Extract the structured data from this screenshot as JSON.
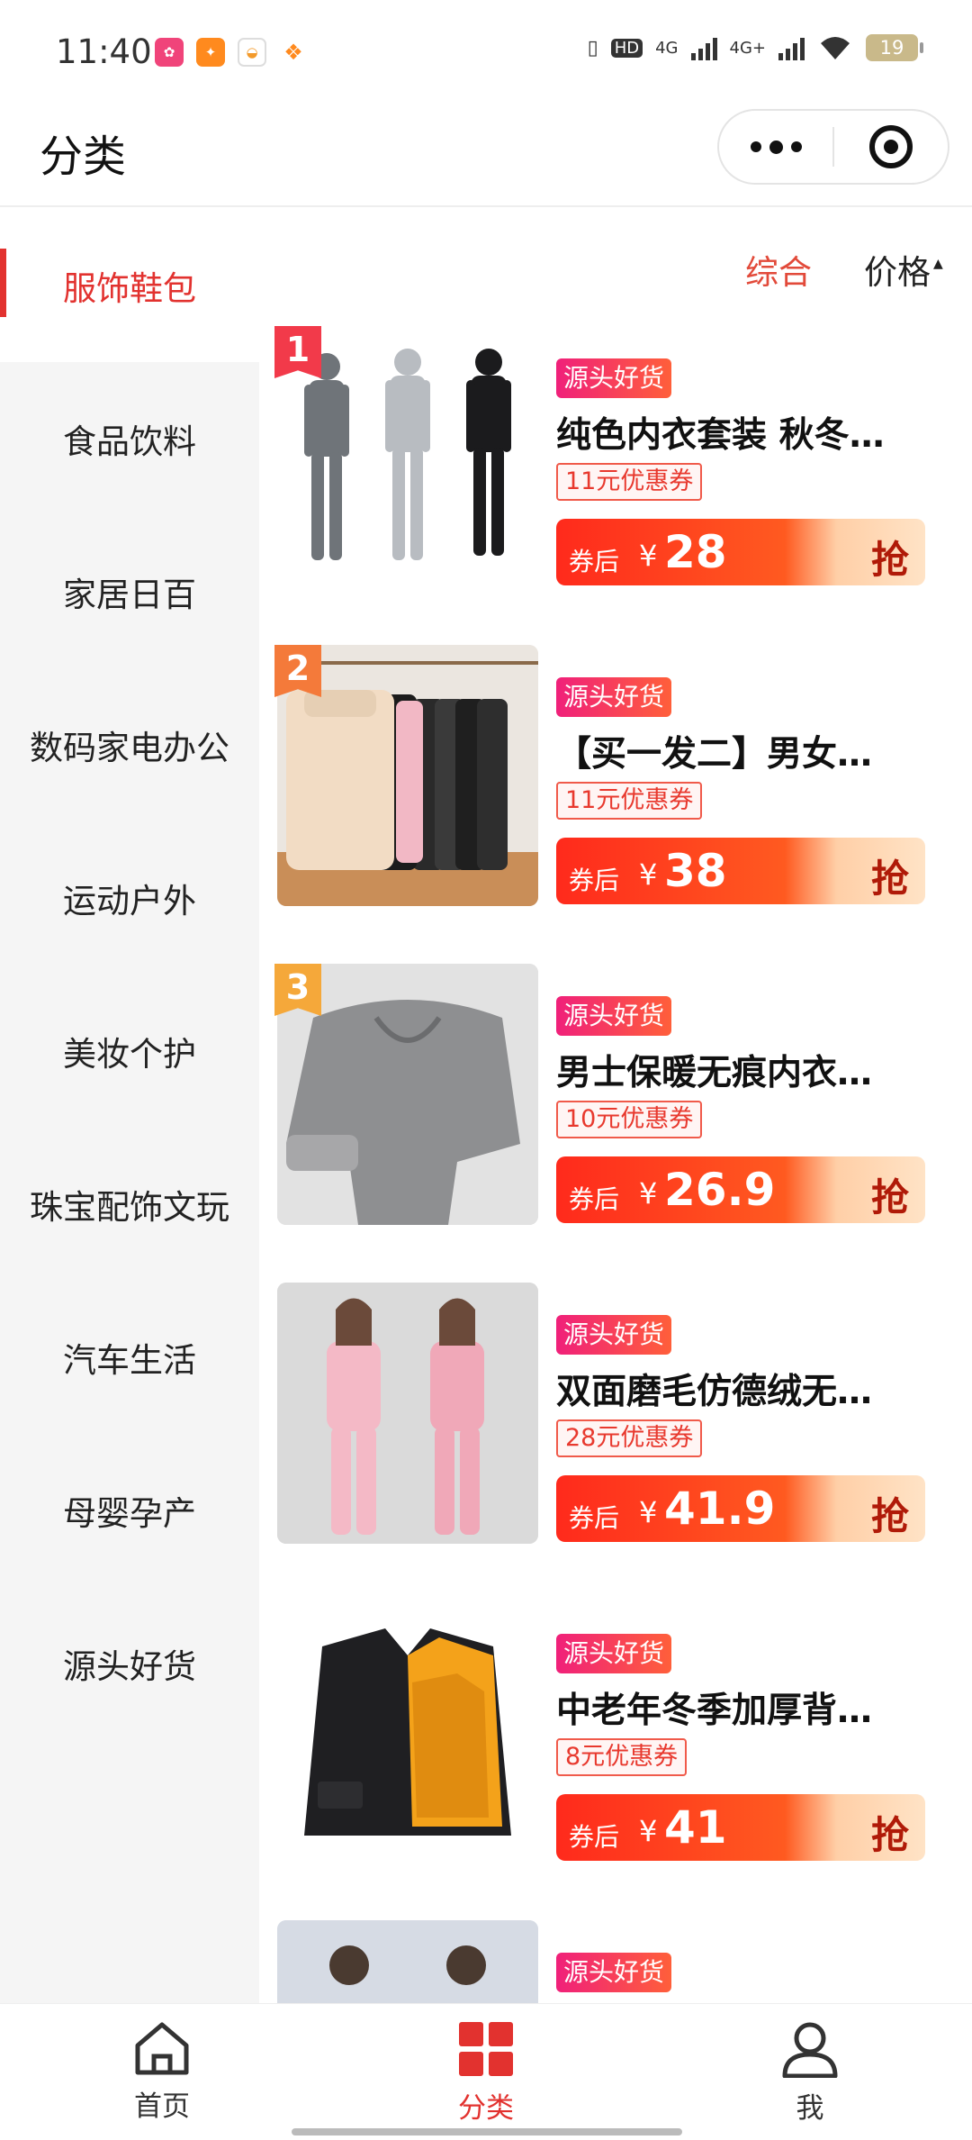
{
  "status_bar": {
    "time": "11:40",
    "network": [
      "4G",
      "4G+"
    ],
    "battery": "19"
  },
  "header": {
    "title": "分类"
  },
  "sidebar": {
    "items": [
      {
        "label": "服饰鞋包",
        "active": true
      },
      {
        "label": "食品饮料"
      },
      {
        "label": "家居日百"
      },
      {
        "label": "数码家电办公"
      },
      {
        "label": "运动户外"
      },
      {
        "label": "美妆个护"
      },
      {
        "label": "珠宝配饰文玩"
      },
      {
        "label": "汽车生活"
      },
      {
        "label": "母婴孕产"
      },
      {
        "label": "源头好货"
      }
    ]
  },
  "sort": {
    "default_label": "综合",
    "price_label": "价格"
  },
  "products": [
    {
      "rank": "1",
      "tag": "源头好货",
      "title": "纯色内衣套装 秋冬…",
      "coupon": "11元优惠券",
      "price_label": "券后",
      "currency": "¥",
      "price": "28",
      "buy": "抢"
    },
    {
      "rank": "2",
      "tag": "源头好货",
      "title": "【买一发二】男女…",
      "coupon": "11元优惠券",
      "price_label": "券后",
      "currency": "¥",
      "price": "38",
      "buy": "抢"
    },
    {
      "rank": "3",
      "tag": "源头好货",
      "title": "男士保暖无痕内衣…",
      "coupon": "10元优惠券",
      "price_label": "券后",
      "currency": "¥",
      "price": "26.9",
      "buy": "抢"
    },
    {
      "tag": "源头好货",
      "title": "双面磨毛仿德绒无…",
      "coupon": "28元优惠券",
      "price_label": "券后",
      "currency": "¥",
      "price": "41.9",
      "buy": "抢"
    },
    {
      "tag": "源头好货",
      "title": "中老年冬季加厚背…",
      "coupon": "8元优惠券",
      "price_label": "券后",
      "currency": "¥",
      "price": "41",
      "buy": "抢"
    },
    {
      "tag": "源头好货"
    }
  ],
  "tabbar": {
    "items": [
      {
        "label": "首页",
        "icon": "home-icon"
      },
      {
        "label": "分类",
        "icon": "category-grid-icon",
        "active": true
      },
      {
        "label": "我",
        "icon": "profile-icon"
      }
    ]
  },
  "colors": {
    "accent": "#e2322f",
    "tag_gradient": [
      "#f0207a",
      "#ff5f3a"
    ]
  }
}
